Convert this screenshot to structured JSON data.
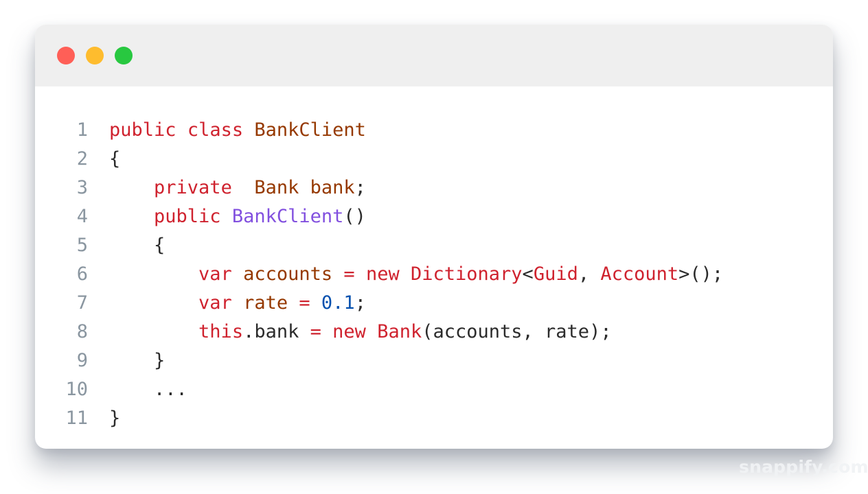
{
  "colors": {
    "close": "#ff5f57",
    "minimize": "#febc2e",
    "maximize": "#28c840",
    "keyword": "#cf222e",
    "type": "#953800",
    "function": "#8250df",
    "number": "#0550ae",
    "plain": "#2b2b2b",
    "line_number": "#8a96a0"
  },
  "window_controls": [
    "close",
    "minimize",
    "maximize"
  ],
  "code": {
    "lines": [
      {
        "number": "1",
        "tokens": [
          {
            "t": "public",
            "k": "keyword"
          },
          {
            "t": " ",
            "k": "plain"
          },
          {
            "t": "class",
            "k": "keyword"
          },
          {
            "t": " ",
            "k": "plain"
          },
          {
            "t": "BankClient",
            "k": "type"
          }
        ]
      },
      {
        "number": "2",
        "tokens": [
          {
            "t": "{",
            "k": "plain"
          }
        ]
      },
      {
        "number": "3",
        "tokens": [
          {
            "t": "    ",
            "k": "plain"
          },
          {
            "t": "private",
            "k": "keyword"
          },
          {
            "t": "  ",
            "k": "plain"
          },
          {
            "t": "Bank",
            "k": "type"
          },
          {
            "t": " ",
            "k": "plain"
          },
          {
            "t": "bank",
            "k": "type"
          },
          {
            "t": ";",
            "k": "plain"
          }
        ]
      },
      {
        "number": "4",
        "tokens": [
          {
            "t": "    ",
            "k": "plain"
          },
          {
            "t": "public",
            "k": "keyword"
          },
          {
            "t": " ",
            "k": "plain"
          },
          {
            "t": "BankClient",
            "k": "function"
          },
          {
            "t": "()",
            "k": "plain"
          }
        ]
      },
      {
        "number": "5",
        "tokens": [
          {
            "t": "    {",
            "k": "plain"
          }
        ]
      },
      {
        "number": "6",
        "tokens": [
          {
            "t": "        ",
            "k": "plain"
          },
          {
            "t": "var",
            "k": "keyword"
          },
          {
            "t": " ",
            "k": "plain"
          },
          {
            "t": "accounts",
            "k": "type"
          },
          {
            "t": " ",
            "k": "plain"
          },
          {
            "t": "=",
            "k": "keyword"
          },
          {
            "t": " ",
            "k": "plain"
          },
          {
            "t": "new",
            "k": "keyword"
          },
          {
            "t": " ",
            "k": "plain"
          },
          {
            "t": "Dictionary",
            "k": "keyword"
          },
          {
            "t": "<",
            "k": "plain"
          },
          {
            "t": "Guid",
            "k": "keyword"
          },
          {
            "t": ", ",
            "k": "plain"
          },
          {
            "t": "Account",
            "k": "keyword"
          },
          {
            "t": ">();",
            "k": "plain"
          }
        ]
      },
      {
        "number": "7",
        "tokens": [
          {
            "t": "        ",
            "k": "plain"
          },
          {
            "t": "var",
            "k": "keyword"
          },
          {
            "t": " ",
            "k": "plain"
          },
          {
            "t": "rate",
            "k": "type"
          },
          {
            "t": " ",
            "k": "plain"
          },
          {
            "t": "=",
            "k": "keyword"
          },
          {
            "t": " ",
            "k": "plain"
          },
          {
            "t": "0.1",
            "k": "number"
          },
          {
            "t": ";",
            "k": "plain"
          }
        ]
      },
      {
        "number": "8",
        "tokens": [
          {
            "t": "        ",
            "k": "plain"
          },
          {
            "t": "this",
            "k": "keyword"
          },
          {
            "t": ".bank ",
            "k": "plain"
          },
          {
            "t": "=",
            "k": "keyword"
          },
          {
            "t": " ",
            "k": "plain"
          },
          {
            "t": "new",
            "k": "keyword"
          },
          {
            "t": " ",
            "k": "plain"
          },
          {
            "t": "Bank",
            "k": "keyword"
          },
          {
            "t": "(accounts, rate);",
            "k": "plain"
          }
        ]
      },
      {
        "number": "9",
        "tokens": [
          {
            "t": "    }",
            "k": "plain"
          }
        ]
      },
      {
        "number": "10",
        "tokens": [
          {
            "t": "    ...",
            "k": "plain"
          }
        ]
      },
      {
        "number": "11",
        "tokens": [
          {
            "t": "}",
            "k": "plain"
          }
        ]
      }
    ]
  },
  "watermark": "snappify.com"
}
